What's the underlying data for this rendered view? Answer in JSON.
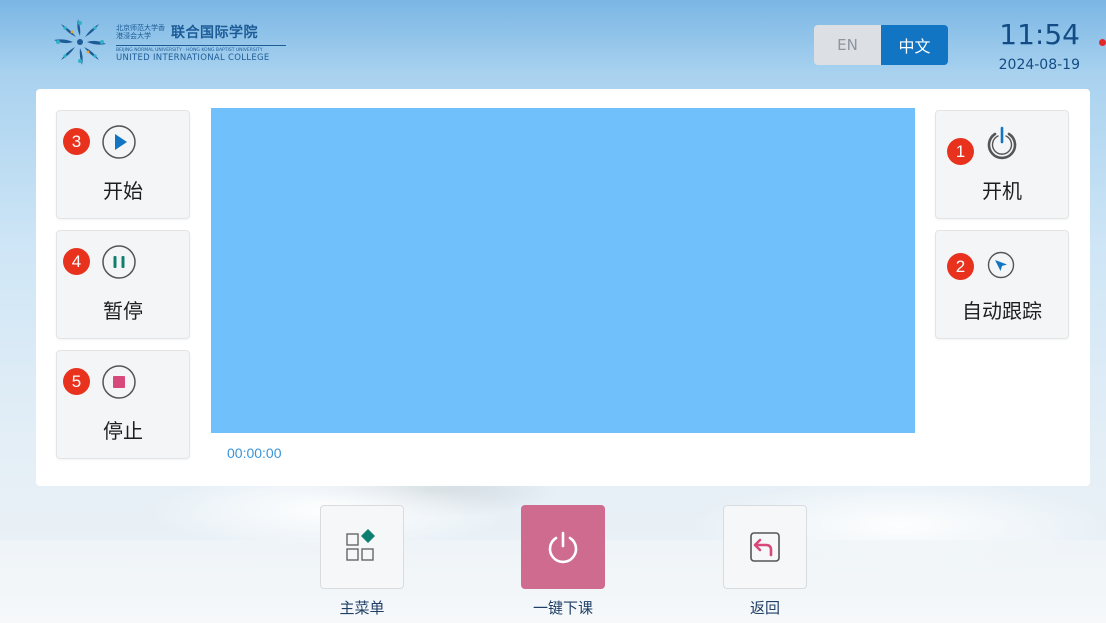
{
  "header": {
    "logo": {
      "cn_small": "北京师范大学香港浸会大学",
      "cn_name": "联合国际学院",
      "en_sub": "BEIJING NORMAL UNIVERSITY · HONG KONG BAPTIST UNIVERSITY",
      "en_name": "UNITED INTERNATIONAL COLLEGE"
    },
    "language": {
      "en_label": "EN",
      "cn_label": "中文",
      "selected": "中文"
    },
    "time": "11:54",
    "date": "2024-08-19"
  },
  "left_controls": [
    {
      "badge": "3",
      "label": "开始",
      "icon": "play-icon"
    },
    {
      "badge": "4",
      "label": "暂停",
      "icon": "pause-icon"
    },
    {
      "badge": "5",
      "label": "停止",
      "icon": "stop-icon"
    }
  ],
  "right_controls": [
    {
      "badge": "1",
      "label": "开机",
      "icon": "power-icon"
    },
    {
      "badge": "2",
      "label": "自动跟踪",
      "icon": "tracking-icon"
    }
  ],
  "video": {
    "timecode": "00:00:00"
  },
  "dock": [
    {
      "label": "主菜单",
      "icon": "main-menu-icon"
    },
    {
      "label": "一键下课",
      "icon": "power-icon"
    },
    {
      "label": "返回",
      "icon": "back-icon"
    }
  ],
  "colors": {
    "accent_blue": "#1275c4",
    "badge_red": "#e8321e",
    "video_blue": "#70c1fb",
    "power_pink": "#cf6b8f",
    "stop_pink": "#d6497a",
    "pause_green": "#0e7f70"
  }
}
